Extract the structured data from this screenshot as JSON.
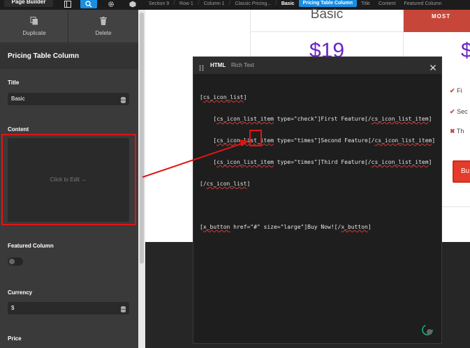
{
  "topbar": {
    "page_builder_label": "Page Builder",
    "breadcrumbs": [
      {
        "label": "Section 9"
      },
      {
        "label": "Row 1"
      },
      {
        "label": "Column 1"
      },
      {
        "label": "Classic Pricing..."
      },
      {
        "label": "Basic"
      },
      {
        "label": "Pricing Table Column"
      },
      {
        "label": "Title"
      },
      {
        "label": "Content"
      },
      {
        "label": "Featured Column"
      }
    ]
  },
  "sidebar": {
    "duplicate_label": "Duplicate",
    "delete_label": "Delete",
    "section_title": "Pricing Table Column",
    "title_label": "Title",
    "title_value": "Basic",
    "content_label": "Content",
    "content_placeholder": "Click to Edit →",
    "featured_label": "Featured Column",
    "featured_on": false,
    "currency_label": "Currency",
    "currency_value": "$",
    "price_label": "Price"
  },
  "preview": {
    "basic_title": "Basic",
    "basic_price": "$19",
    "popular_banner": "MOST",
    "popular_price": "$",
    "features": [
      {
        "icon": "check",
        "text": "Fi"
      },
      {
        "icon": "check",
        "text": "Sec"
      },
      {
        "icon": "times",
        "text": "Th"
      }
    ],
    "popular_button": "Bu"
  },
  "modal": {
    "tab_html": "HTML",
    "tab_rich_text": "Rich Text",
    "code_lines": [
      "[cs_icon_list]",
      "    [cs_icon_list_item type=\"check\"]First Feature[/cs_icon_list_item]",
      "    [cs_icon_list_item type=\"times\"]Second Feature[/cs_icon_list_item]",
      "    [cs_icon_list_item type=\"times\"]Third Feature[/cs_icon_list_item]",
      "[/cs_icon_list]",
      "",
      "[x_button href=\"#\" size=\"large\"]Buy Now![/x_button]"
    ]
  },
  "colors": {
    "accent": "#1a8ee1",
    "annotation_red": "#e01414",
    "price_purple": "#6c23c6",
    "popular_red": "#c7463a"
  }
}
